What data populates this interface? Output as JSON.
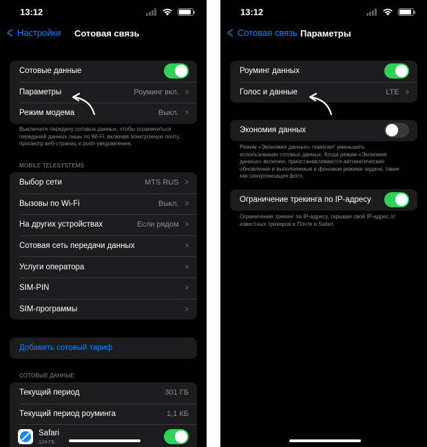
{
  "status_bar": {
    "time": "13:12"
  },
  "left": {
    "nav": {
      "back_label": "Настройки",
      "title": "Сотовая связь"
    },
    "group1": [
      {
        "label": "Сотовые данные",
        "toggle": true
      },
      {
        "label": "Параметры",
        "value": "Роуминг вкл."
      },
      {
        "label": "Режим модема",
        "value": "Выкл."
      }
    ],
    "footnote1": "Выключите передачу сотовых данных, чтобы ограничиться передачей данных лишь по Wi-Fi, включая электронную почту, просмотр веб-страниц и push-уведомления.",
    "section_carrier": "MOBILE TELESYSTEMS",
    "group2": [
      {
        "label": "Выбор сети",
        "value": "MTS RUS"
      },
      {
        "label": "Вызовы по Wi-Fi",
        "value": "Выкл."
      },
      {
        "label": "На других устройствах",
        "value": "Если рядом"
      },
      {
        "label": "Сотовая сеть передачи данных",
        "value": ""
      },
      {
        "label": "Услуги оператора",
        "value": ""
      },
      {
        "label": "SIM-PIN",
        "value": ""
      },
      {
        "label": "SIM-программы",
        "value": ""
      }
    ],
    "add_plan_label": "Добавить сотовый тариф",
    "section_data": "СОТОВЫЕ ДАННЫЕ",
    "group3": [
      {
        "label": "Текущий период",
        "value": "301 ГБ"
      },
      {
        "label": "Текущий период роуминга",
        "value": "1,1 КБ"
      }
    ],
    "app": {
      "name": "Safari",
      "size": "124 ГБ",
      "toggle": true
    }
  },
  "right": {
    "nav": {
      "back_label": "Сотовая связь",
      "title": "Параметры"
    },
    "group1": [
      {
        "label": "Роуминг данных",
        "toggle": true
      },
      {
        "label": "Голос и данные",
        "value": "LTE"
      }
    ],
    "low_data": {
      "label": "Экономия данных",
      "toggle": false
    },
    "footnote_low_data": "Режим «Экономия данных» помогает уменьшить использование сотовых данных. Когда режим «Экономия данных» включен, приостанавливаются автоматические обновления и выполняемые в фоновом режиме задачи, такие как синхронизация фото.",
    "ip_tracking": {
      "label": "Ограничение трекинга по IP-адресу",
      "toggle": true
    },
    "footnote_ip": "Ограничение трекинг по IP-адресу, скрывая свой IP-адрес от известных трекеров в Почте и Safari."
  },
  "colors": {
    "accent": "#0a84ff",
    "toggle_on": "#30d158",
    "cell_bg": "#1c1c1e",
    "secondary_text": "#8e8e93"
  },
  "icons": [
    "signal-icon",
    "wifi-icon",
    "battery-icon",
    "chevron-left-icon",
    "chevron-right-icon",
    "toggle-icon",
    "safari-app-icon",
    "annotation-arrow-icon"
  ]
}
